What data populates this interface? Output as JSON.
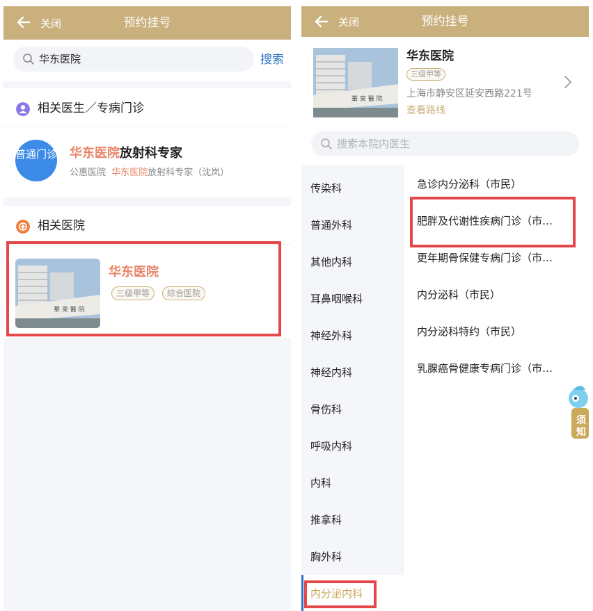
{
  "left": {
    "header": {
      "close_label": "关闭",
      "title": "预约挂号"
    },
    "search": {
      "query": "华东医院",
      "button_label": "搜索"
    },
    "doctor_section": {
      "heading": "相关医生／专病门诊",
      "avatar_label": "普通门诊",
      "title_highlight": "华东医院",
      "title_rest": "放射科专家",
      "sub_prefix": "公惠医院",
      "sub_highlight": "华东医院",
      "sub_rest": "放射科专家（沈岚）"
    },
    "hospital_section": {
      "heading": "相关医院",
      "name": "华东医院",
      "badges": [
        "三级甲等",
        "综合医院"
      ]
    }
  },
  "right": {
    "header": {
      "close_label": "关闭",
      "title": "预约挂号"
    },
    "hospital": {
      "name": "华东医院",
      "badge": "三级甲等",
      "address": "上海市静安区延安西路221号",
      "route_label": "查看路线"
    },
    "search_placeholder": "搜索本院内医生",
    "departments": [
      "传染科",
      "普通外科",
      "其他内科",
      "耳鼻咽喉科",
      "神经外科",
      "神经内科",
      "骨伤科",
      "呼吸内科",
      "内科",
      "推拿科",
      "胸外科"
    ],
    "active_department": "内分泌内科",
    "clinics": [
      "急诊内分泌科（市民）",
      "肥胖及代谢性疾病门诊（市…",
      "更年期骨保健专病门诊（市…",
      "内分泌科（市民）",
      "内分泌科特约（市民）",
      "乳腺癌骨健康专病门诊（市…"
    ],
    "notice_label": "须知"
  },
  "colors": {
    "header": "#c9b07d",
    "accent_blue": "#2c6fc2",
    "highlight": "#e98467",
    "annotation_red": "#e5474b"
  }
}
